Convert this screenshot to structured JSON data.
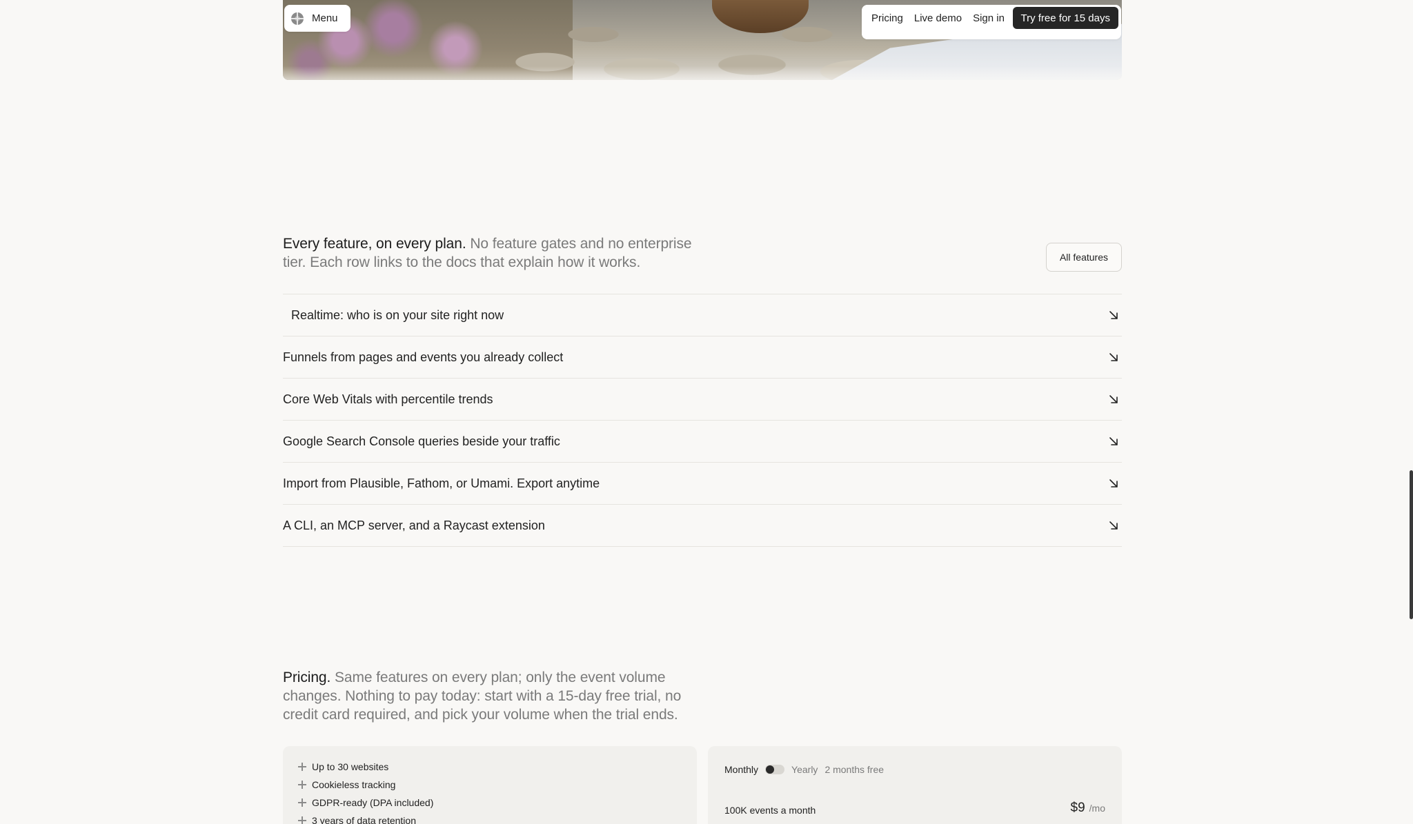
{
  "nav": {
    "menu_label": "Menu",
    "links": [
      "Pricing",
      "Live demo",
      "Sign in"
    ],
    "cta_label": "Try free for 15 days"
  },
  "features": {
    "lead": "Every feature, on every plan.",
    "body": " No feature gates and no enterprise tier. Each row links to the docs that explain how it works.",
    "all_features_label": "All features",
    "rows": [
      "Realtime: who is on your site right now",
      "Funnels from pages and events you already collect",
      "Core Web Vitals with percentile trends",
      "Google Search Console queries beside your traffic",
      "Import from Plausible, Fathom, or Umami. Export anytime",
      "A CLI, an MCP server, and a Raycast extension"
    ]
  },
  "pricing": {
    "lead": "Pricing.",
    "body": " Same features on every plan; only the event volume changes. Nothing to pay today: start with a 15-day free trial, no credit card required, and pick your volume when the trial ends.",
    "included": [
      "Up to 30 websites",
      "Cookieless tracking",
      "GDPR-ready (DPA included)",
      "3 years of data retention"
    ],
    "billing": {
      "monthly": "Monthly",
      "yearly": "Yearly",
      "yearly_note": "2 months free",
      "yearly_selected": false
    },
    "volume_label": "100K events a month",
    "price": "$9",
    "period": "/mo"
  }
}
